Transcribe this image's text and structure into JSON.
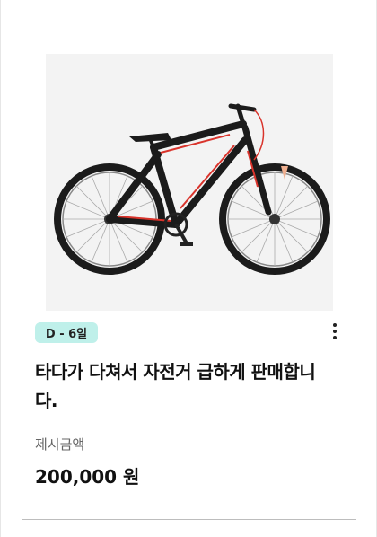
{
  "listing": {
    "image_icon": "bicycle",
    "badge": "D - 6일",
    "title": "타다가 다쳐서 자전거 급하게 판매합니다.",
    "price_label": "제시금액",
    "price_value": "200,000 원",
    "more_icon": "more-vertical-icon"
  },
  "colors": {
    "badge_bg": "#bff0ea",
    "bike_frame": "#1b1b1b",
    "bike_accent": "#d9332b"
  }
}
